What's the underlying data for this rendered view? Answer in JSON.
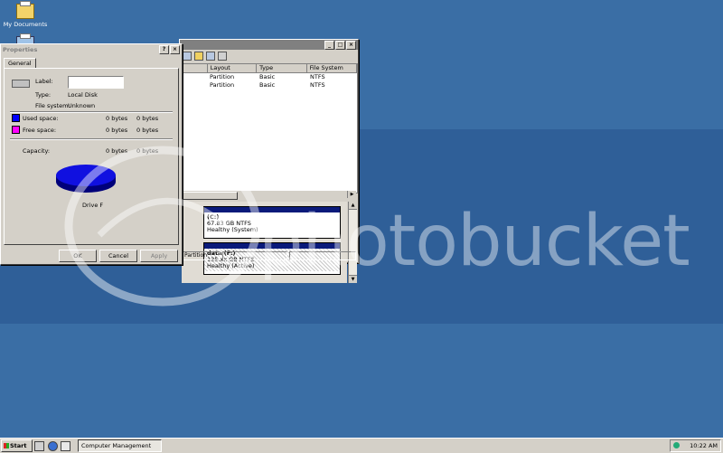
{
  "desktop": {
    "icons": [
      {
        "label": "My Documents",
        "icon": "folder-icon"
      }
    ]
  },
  "computer_management": {
    "list": {
      "columns": [
        "Layout",
        "Type",
        "File System"
      ],
      "rows": [
        {
          "layout": "Partition",
          "type": "Basic",
          "fs": "NTFS"
        },
        {
          "layout": "Partition",
          "type": "Basic",
          "fs": "NTFS"
        }
      ]
    },
    "volumes": [
      {
        "name": "(C:)",
        "size": "67.83 GB NTFS",
        "status": "Healthy (System)"
      },
      {
        "name": "data (F:)",
        "size": "135.xx GB NTFS",
        "status": "Healthy (Active)"
      }
    ],
    "status_cells": [
      "Partition",
      "",
      ""
    ]
  },
  "properties": {
    "title": "Properties",
    "tab": "General",
    "label_caption": "Label:",
    "label_value": "",
    "type_caption": "Type:",
    "type_value": "Local Disk",
    "fs_caption": "File system:",
    "fs_value": "Unknown",
    "used_caption": "Used space:",
    "used_bytes": "0 bytes",
    "used_size": "0 bytes",
    "free_caption": "Free space:",
    "free_bytes": "0 bytes",
    "free_size": "0 bytes",
    "capacity_caption": "Capacity:",
    "capacity_bytes": "0 bytes",
    "capacity_size": "0 bytes",
    "drive_caption": "Drive F",
    "buttons": {
      "ok": "OK",
      "cancel": "Cancel",
      "apply": "Apply"
    },
    "colors": {
      "used": "#0000ff",
      "free": "#ff00ff"
    }
  },
  "watermark": {
    "text": "photobucket"
  },
  "taskbar": {
    "start_label": "Start",
    "task_label": "Computer Management",
    "clock": "10:22 AM"
  }
}
